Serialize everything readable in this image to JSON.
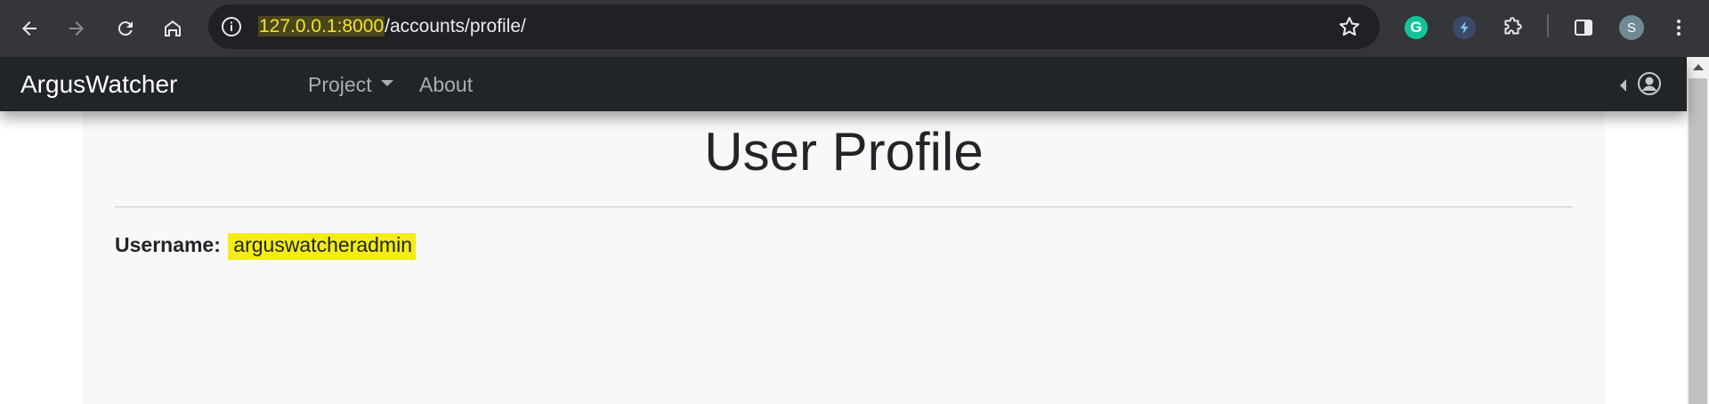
{
  "browser": {
    "url_host": "127.0.0.1:8000",
    "url_path": "/accounts/profile/",
    "profile_initial": "S",
    "extension_grammarly_label": "G"
  },
  "navbar": {
    "brand": "ArgusWatcher",
    "items": [
      {
        "label": "Project",
        "has_dropdown": true
      },
      {
        "label": "About",
        "has_dropdown": false
      }
    ]
  },
  "page": {
    "title": "User Profile",
    "username_label": "Username:",
    "username_value": "arguswatcheradmin"
  },
  "colors": {
    "chrome_bg": "#35363a",
    "omnibox_bg": "#202124",
    "navbar_bg": "#212529",
    "container_bg": "#f8f8f8",
    "highlight": "#f4ec15"
  }
}
